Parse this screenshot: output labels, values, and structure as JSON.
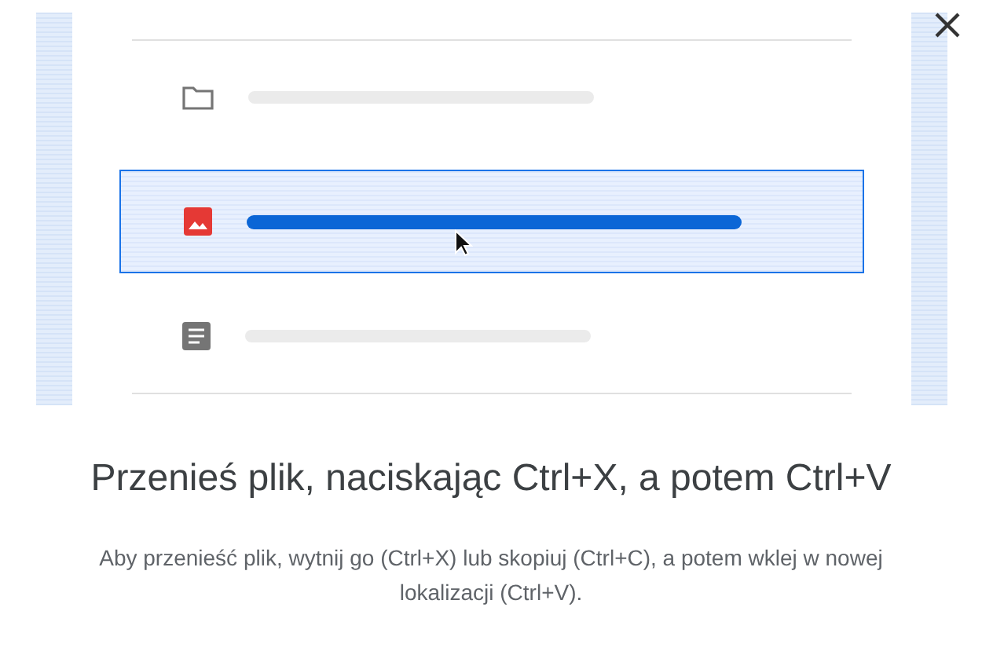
{
  "illustration": {
    "rows": [
      {
        "kind": "folder",
        "selected": false
      },
      {
        "kind": "image",
        "selected": true
      },
      {
        "kind": "document",
        "selected": false
      }
    ]
  },
  "title": "Przenieś plik, naciskając Ctrl+X, a potem Ctrl+V",
  "description": "Aby przenieść plik, wytnij go (Ctrl+X) lub skopiuj (Ctrl+C), a potem wklej w nowej lokalizacji (Ctrl+V)."
}
